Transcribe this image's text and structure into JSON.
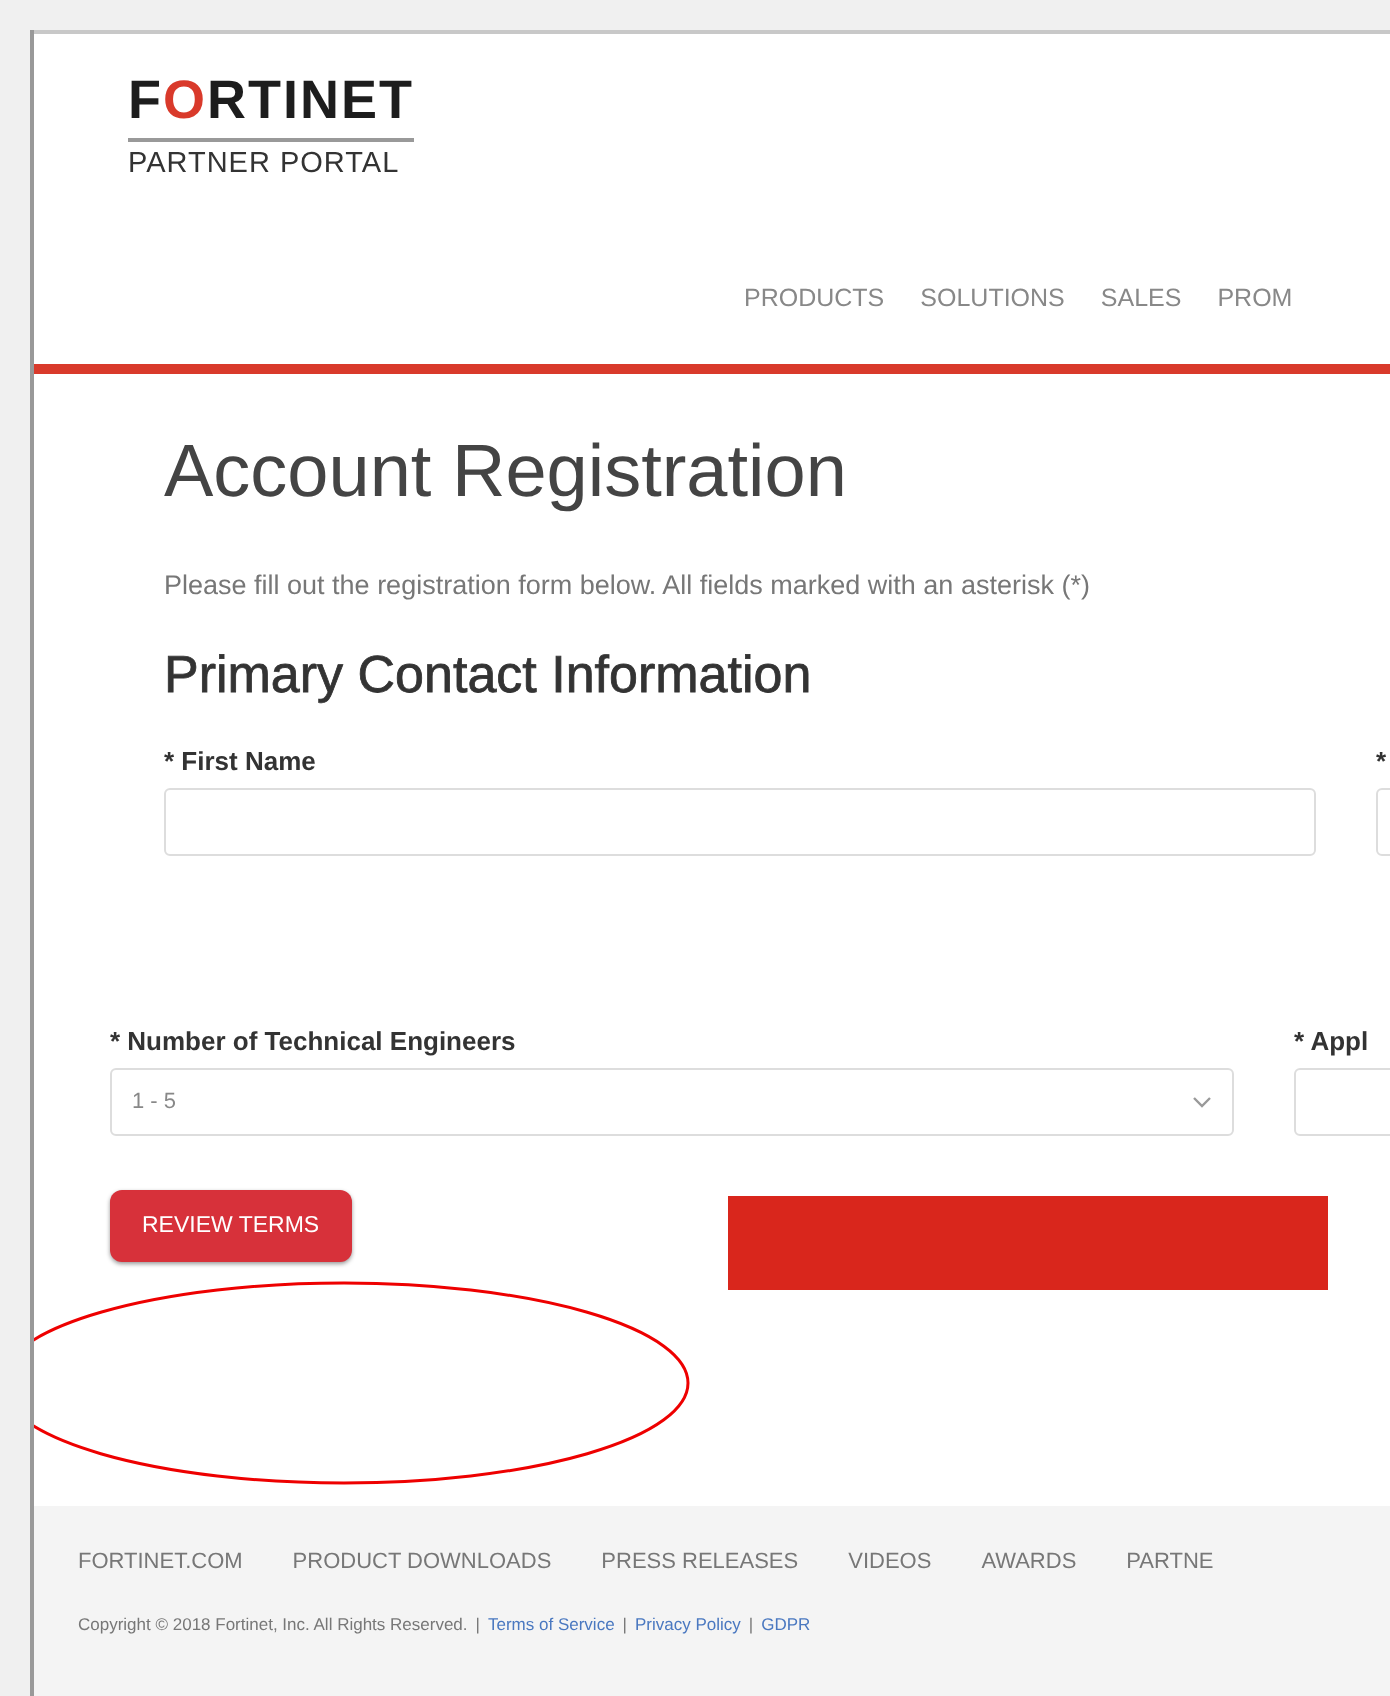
{
  "header": {
    "logo": "FORTINET",
    "subtitle": "PARTNER PORTAL",
    "nav": [
      "PRODUCTS",
      "SOLUTIONS",
      "SALES",
      "PROM"
    ]
  },
  "title": "Account Registration",
  "intro": "Please fill out the registration form below. All fields marked with an asterisk (*)",
  "section": "Primary Contact Information",
  "contact_fields": [
    {
      "label": "* First Name",
      "kind": "text"
    },
    {
      "label": "*",
      "kind": "text"
    }
  ],
  "engineer_fields": [
    {
      "label": "* Number of Technical Engineers",
      "kind": "select",
      "value": "1 - 5"
    },
    {
      "label": "* Appl",
      "kind": "text"
    }
  ],
  "buttons": [
    {
      "label": "REVIEW TERMS",
      "kind": "labeled"
    },
    {
      "kind": "bar"
    }
  ],
  "footer": {
    "links": [
      "FORTINET.COM",
      "PRODUCT DOWNLOADS",
      "PRESS RELEASES",
      "VIDEOS",
      "AWARDS",
      "PARTNE"
    ],
    "copyright": "Copyright © 2018 Fortinet, Inc. All Rights Reserved.",
    "separator": "|",
    "legal_links": [
      "Terms of Service",
      "Privacy Policy",
      "GDPR"
    ]
  }
}
